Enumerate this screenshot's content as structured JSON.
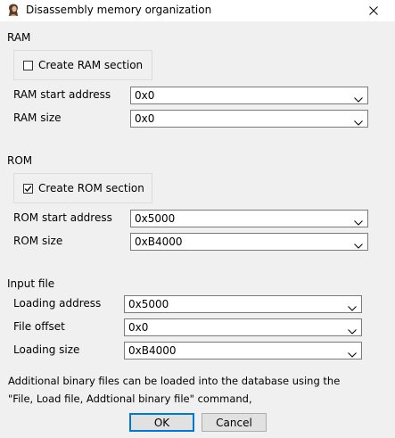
{
  "window": {
    "title": "Disassembly memory organization",
    "app_icon": "ida-portrait-icon",
    "close_icon": "close-icon"
  },
  "ram": {
    "heading": "RAM",
    "create_label": "Create RAM section",
    "create_checked": false,
    "start_label": "RAM start address",
    "start_value": "0x0",
    "size_label": "RAM size",
    "size_value": "0x0"
  },
  "rom": {
    "heading": "ROM",
    "create_label": "Create ROM section",
    "create_checked": true,
    "start_label": "ROM start address",
    "start_value": "0x5000",
    "size_label": "ROM size",
    "size_value": "0xB4000"
  },
  "input_file": {
    "heading": "Input file",
    "loading_address_label": "Loading address",
    "loading_address_value": "0x5000",
    "file_offset_label": "File offset",
    "file_offset_value": "0x0",
    "loading_size_label": "Loading size",
    "loading_size_value": "0xB4000"
  },
  "note": {
    "line1": "Additional binary files can be loaded into the database using the",
    "line2": "\"File, Load file, Addtional binary file\" command,"
  },
  "buttons": {
    "ok": "OK",
    "cancel": "Cancel"
  }
}
